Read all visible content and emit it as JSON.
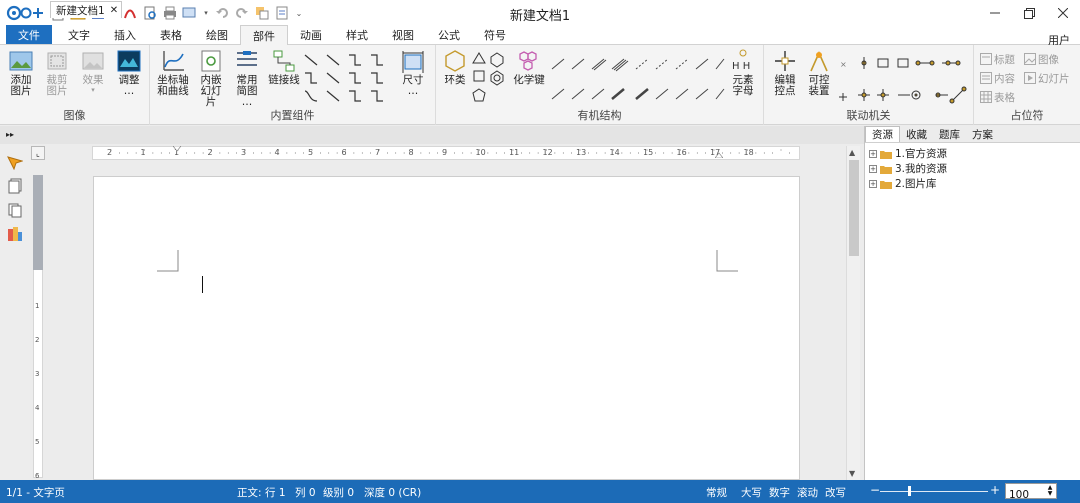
{
  "window": {
    "title": "新建文档1"
  },
  "quick_access": [
    "app-logo-icon",
    "new-icon",
    "open-icon",
    "save-icon",
    "dropdown-icon",
    "pdf-icon",
    "print-preview-icon",
    "print-icon",
    "screen-icon",
    "undo-icon",
    "redo-icon",
    "cut-icon",
    "copy-icon",
    "more-icon"
  ],
  "tabs": [
    "文件",
    "文字",
    "插入",
    "表格",
    "绘图",
    "部件",
    "动画",
    "样式",
    "视图",
    "公式",
    "符号"
  ],
  "active_tab": "部件",
  "user_label": "用户",
  "ribbon": {
    "image_group": {
      "label": "图像",
      "add_image": "添加\n图片",
      "crop_image": "裁剪\n图片",
      "effect": "效果",
      "adjust": "调整\n…"
    },
    "builtin_group": {
      "label": "内置组件",
      "axis_curve": "坐标轴\n和曲线",
      "embedded_slide": "内嵌\n幻灯片",
      "common_diagram": "常用\n简图\n…",
      "connector": "链接线",
      "dimension": "尺寸\n…"
    },
    "organic_group": {
      "label": "有机结构",
      "ring": "环类",
      "chem_bond": "化学键",
      "element_letter": "元素\n字母"
    },
    "linkage_group": {
      "label": "联动机关",
      "edit_control_point": "编辑\n控点",
      "controllable_device": "可控\n装置"
    },
    "placeholder_group": {
      "label": "占位符",
      "title": "标题",
      "image": "图像",
      "content": "内容",
      "slide": "幻灯片",
      "table": "表格"
    }
  },
  "document_tab": {
    "name": "新建文档1"
  },
  "ruler_numbers": [
    "2",
    "1",
    "1",
    "2",
    "3",
    "4",
    "5",
    "6",
    "7",
    "8",
    "9",
    "10",
    "11",
    "12",
    "13",
    "14",
    "15",
    "16",
    "17",
    "18"
  ],
  "vruler_numbers": [
    "1",
    "2",
    "3",
    "4",
    "5",
    "6"
  ],
  "right_panel": {
    "tabs": [
      "资源",
      "收藏",
      "题库",
      "方案"
    ],
    "active": "资源",
    "tree": [
      "1.官方资源",
      "3.我的资源",
      "2.图片库"
    ]
  },
  "status": {
    "page": "1/1 - 文字页",
    "position_label": "正文:",
    "row": "行 1",
    "col": "列 0",
    "level": "级别 0",
    "depth": "深度 0 (CR)",
    "mode": "常规",
    "caps": "大写",
    "num": "数字",
    "scroll": "滚动",
    "overwrite": "改写",
    "zoom_minus": "−",
    "zoom_plus": "+",
    "zoom_value": "100"
  },
  "colors": {
    "accent": "#1e6fc0",
    "statusbar": "#1c6bb7"
  }
}
